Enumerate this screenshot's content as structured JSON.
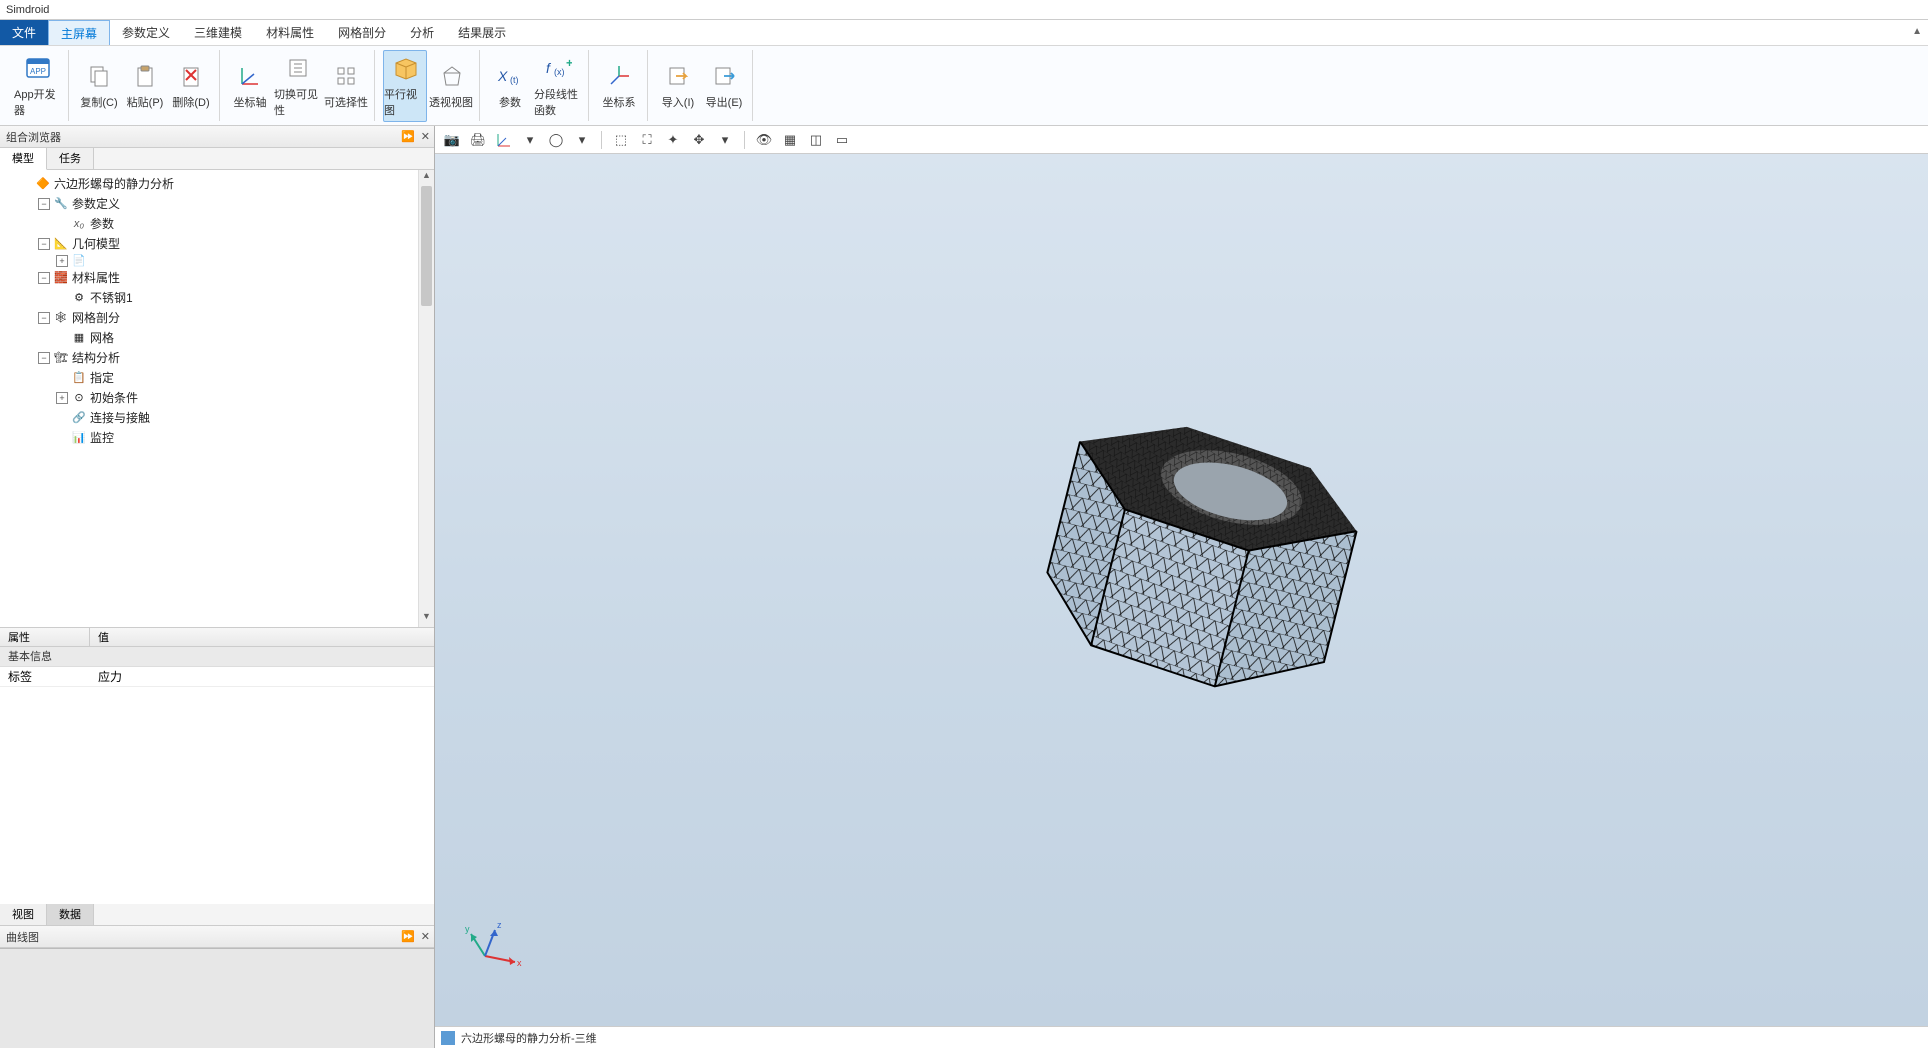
{
  "app_title": "Simdroid",
  "menubar": {
    "file": "文件",
    "tabs": [
      "主屏幕",
      "参数定义",
      "三维建模",
      "材料属性",
      "网格剖分",
      "分析",
      "结果展示"
    ],
    "active_index": 0
  },
  "ribbon": {
    "app_dev": "App开发器",
    "copy": "复制(C)",
    "paste": "粘贴(P)",
    "delete": "删除(D)",
    "axis": "坐标轴",
    "toggle_vis": "切换可见性",
    "selectable": "可选择性",
    "parallel": "平行视图",
    "perspective": "透视视图",
    "param": "参数",
    "piecewise": "分段线性函数",
    "coord": "坐标系",
    "import": "导入(I)",
    "export": "导出(E)"
  },
  "left_panel": {
    "browser_title": "组合浏览器",
    "tab_model": "模型",
    "tab_task": "任务",
    "tree": {
      "root": "六边形螺母的静力分析",
      "param_def": "参数定义",
      "param_item": "参数",
      "geom": "几何模型",
      "material": "材料属性",
      "material_item": "不锈钢1",
      "mesh": "网格剖分",
      "mesh_item": "网格",
      "struct": "结构分析",
      "struct_assign": "指定",
      "struct_init": "初始条件",
      "struct_contact": "连接与接触",
      "struct_monitor": "监控"
    },
    "prop_header_attr": "属性",
    "prop_header_val": "值",
    "prop_section": "基本信息",
    "prop_label_key": "标签",
    "prop_label_val": "应力",
    "tab_view": "视图",
    "tab_data": "数据",
    "curve_title": "曲线图"
  },
  "viewport": {
    "status_label": "六边形螺母的静力分析-三维"
  }
}
